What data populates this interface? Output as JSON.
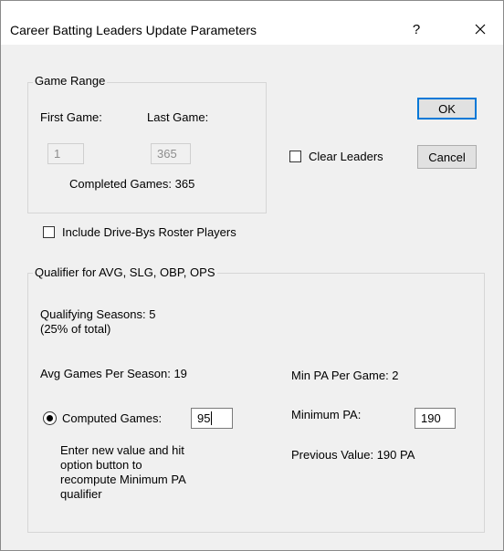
{
  "window": {
    "title": "Career Batting Leaders Update Parameters",
    "help_label": "?"
  },
  "game_range": {
    "legend": "Game Range",
    "first_game_label": "First Game:",
    "first_game_value": "1",
    "last_game_label": "Last Game:",
    "last_game_value": "365",
    "completed_games": "Completed Games: 365"
  },
  "buttons": {
    "ok": "OK",
    "cancel": "Cancel"
  },
  "clear_leaders": {
    "label": "Clear Leaders",
    "checked": false
  },
  "include_driveby": {
    "label": "Include Drive-Bys Roster Players",
    "checked": false
  },
  "qualifier": {
    "legend": "Qualifier for AVG, SLG, OBP, OPS",
    "qualifying_seasons": "Qualifying Seasons: 5",
    "percent_total": "(25% of total)",
    "avg_games": "Avg Games Per Season: 19",
    "min_pa_per_game": "Min PA Per Game: 2",
    "computed_games_label": "Computed Games:",
    "computed_games_value": "95",
    "computed_games_selected": true,
    "minimum_pa_label": "Minimum PA:",
    "minimum_pa_value": "190",
    "help_line1": "Enter new value and hit",
    "help_line2": "option button to",
    "help_line3": "recompute Minimum PA",
    "help_line4": "qualifier",
    "previous_value": "Previous Value: 190 PA"
  }
}
